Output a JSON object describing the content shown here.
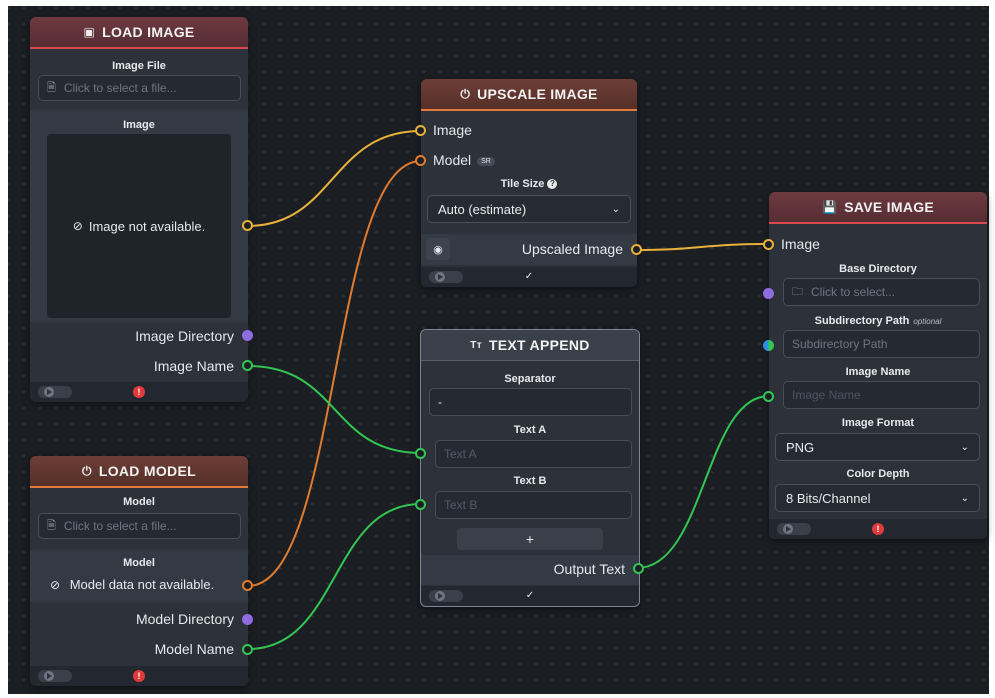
{
  "colors": {
    "image_port": "#e8b23a",
    "model_port": "#e27b2c",
    "text_port": "#33c653",
    "directory_port": "#8f6ce0",
    "error": "#e23a3a"
  },
  "load_image": {
    "title": "LOAD IMAGE",
    "icon": "image-icon",
    "file_label": "Image File",
    "file_placeholder": "Click to select a file...",
    "image_label": "Image",
    "preview_text": "Image not available.",
    "outputs": [
      "Image Directory",
      "Image Name"
    ]
  },
  "load_model": {
    "title": "LOAD MODEL",
    "icon": "power-icon",
    "file_label": "Model",
    "file_placeholder": "Click to select a file...",
    "model_label": "Model",
    "preview_text": "Model data not available.",
    "outputs": [
      "Model Directory",
      "Model Name"
    ]
  },
  "upscale_image": {
    "title": "UPSCALE IMAGE",
    "inputs": [
      "Image",
      "Model"
    ],
    "model_badge": "SR",
    "tile_size_label": "Tile Size",
    "tile_size_value": "Auto (estimate)",
    "output": "Upscaled Image"
  },
  "text_append": {
    "title": "TEXT APPEND",
    "icon_text": "Tт",
    "separator_label": "Separator",
    "separator_value": "-",
    "text_a_label": "Text A",
    "text_a_placeholder": "Text A",
    "text_b_label": "Text B",
    "text_b_placeholder": "Text B",
    "add_label": "+",
    "output": "Output Text"
  },
  "save_image": {
    "title": "SAVE IMAGE",
    "input": "Image",
    "base_dir_label": "Base Directory",
    "base_dir_placeholder": "Click to select...",
    "subdir_label": "Subdirectory Path",
    "subdir_optional": "optional",
    "subdir_placeholder": "Subdirectory Path",
    "image_name_label": "Image Name",
    "image_name_placeholder": "Image Name",
    "format_label": "Image Format",
    "format_value": "PNG",
    "depth_label": "Color Depth",
    "depth_value": "8 Bits/Channel"
  }
}
